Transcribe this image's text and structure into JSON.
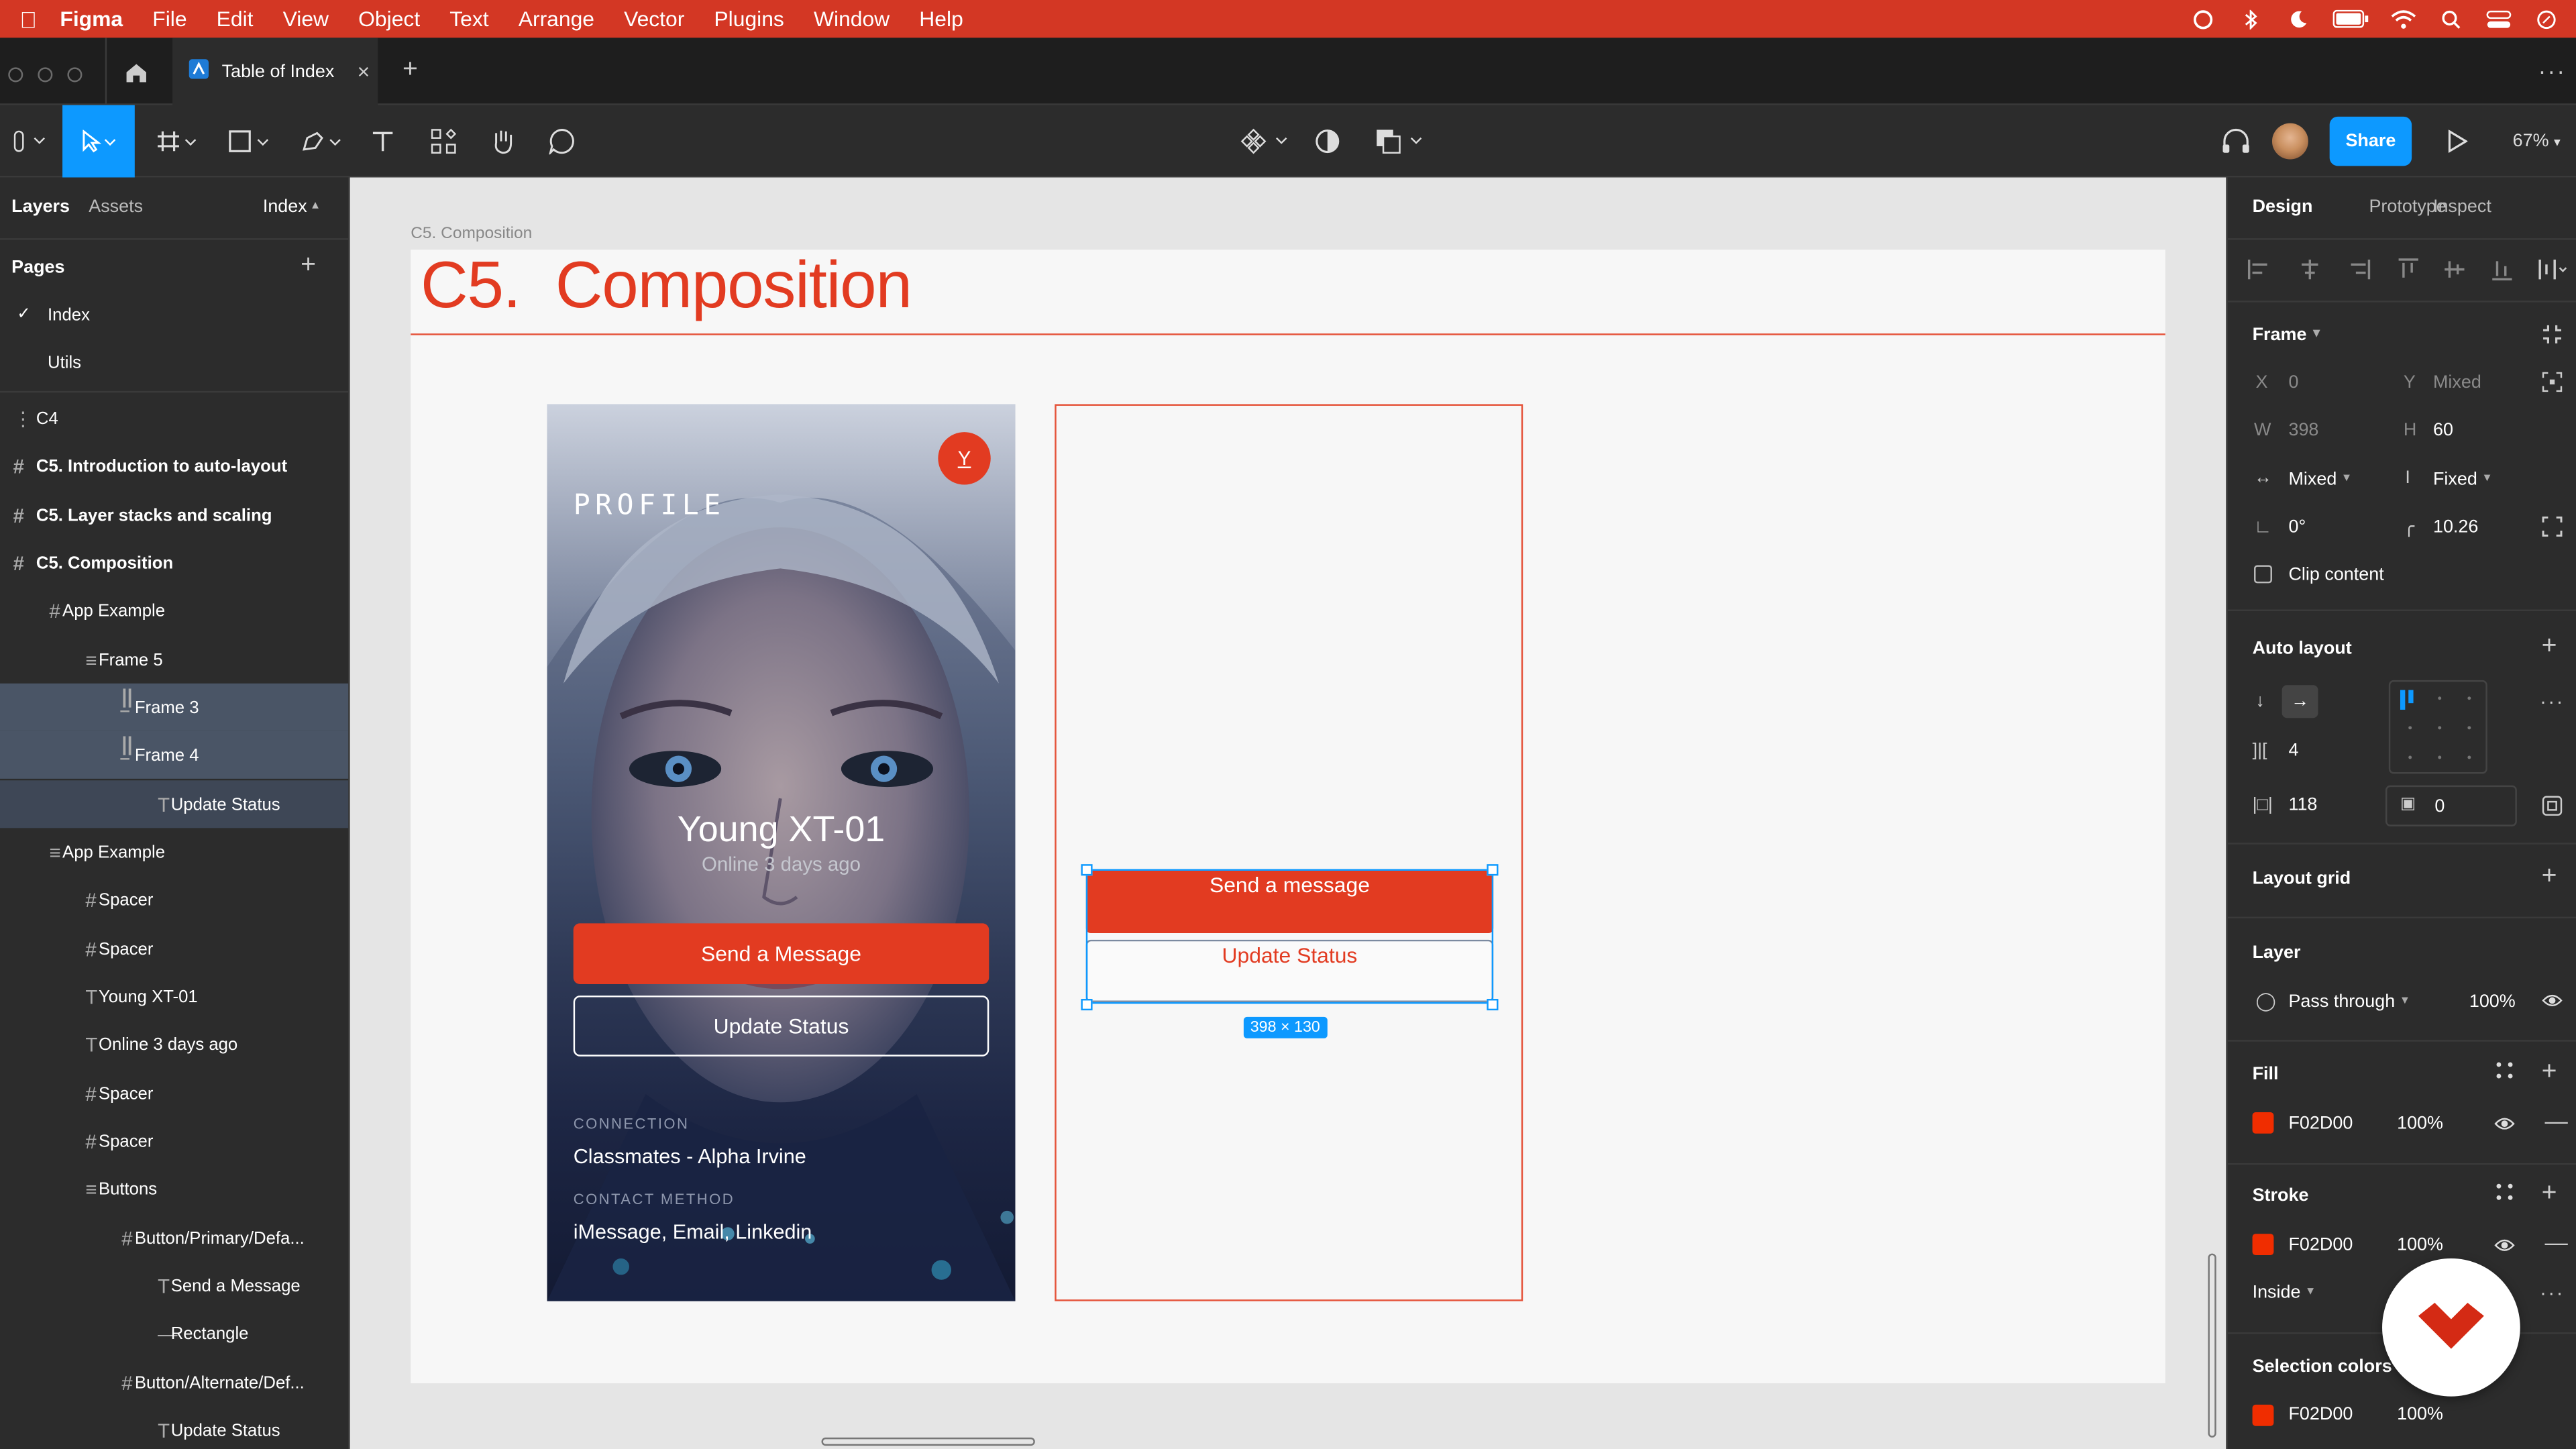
{
  "menubar": {
    "app": "Figma",
    "items": [
      "File",
      "Edit",
      "View",
      "Object",
      "Text",
      "Arrange",
      "Vector",
      "Plugins",
      "Window",
      "Help"
    ]
  },
  "tabs": {
    "active_title": "Table of Index",
    "add_label": "+",
    "close_label": "×"
  },
  "toolbar": {
    "share_label": "Share",
    "zoom_label": "67%"
  },
  "left_panel": {
    "tab_layers": "Layers",
    "tab_assets": "Assets",
    "page_selector": "Index",
    "pages_title": "Pages",
    "pages": [
      {
        "label": "Index",
        "active": true
      },
      {
        "label": "Utils",
        "active": false
      }
    ],
    "layers": [
      {
        "label": "C4",
        "icon": "dashed-frame-icon",
        "indent": 0,
        "bold": false
      },
      {
        "label": "C5. Introduction to auto-layout",
        "icon": "frame-icon",
        "indent": 0,
        "bold": true
      },
      {
        "label": "C5. Layer stacks and scaling",
        "icon": "frame-icon",
        "indent": 0,
        "bold": true
      },
      {
        "label": "C5. Composition",
        "icon": "frame-icon",
        "indent": 0,
        "bold": true
      },
      {
        "label": "App Example",
        "icon": "frame-icon",
        "indent": 1,
        "bold": false
      },
      {
        "label": "Frame 5",
        "icon": "autolayout-vertical-icon",
        "indent": 2,
        "bold": false
      },
      {
        "label": "Frame 3",
        "icon": "autolayout-horizontal-icon",
        "indent": 3,
        "bold": false,
        "selected": true
      },
      {
        "label": "Frame 4",
        "icon": "autolayout-horizontal-icon",
        "indent": 3,
        "bold": false,
        "selected": true
      },
      {
        "label": "Update Status",
        "icon": "text-icon",
        "indent": 4,
        "bold": false,
        "selected2": true
      },
      {
        "label": "App Example",
        "icon": "autolayout-vertical-icon",
        "indent": 1,
        "bold": false
      },
      {
        "label": "Spacer",
        "icon": "frame-icon",
        "indent": 2,
        "bold": false
      },
      {
        "label": "Spacer",
        "icon": "frame-icon",
        "indent": 2,
        "bold": false
      },
      {
        "label": "Young XT-01",
        "icon": "text-icon",
        "indent": 2,
        "bold": false
      },
      {
        "label": "Online 3 days ago",
        "icon": "text-icon",
        "indent": 2,
        "bold": false
      },
      {
        "label": "Spacer",
        "icon": "frame-icon",
        "indent": 2,
        "bold": false
      },
      {
        "label": "Spacer",
        "icon": "frame-icon",
        "indent": 2,
        "bold": false
      },
      {
        "label": "Buttons",
        "icon": "autolayout-vertical-icon",
        "indent": 2,
        "bold": false
      },
      {
        "label": "Button/Primary/Defa...",
        "icon": "frame-icon",
        "indent": 3,
        "bold": false
      },
      {
        "label": "Send a Message",
        "icon": "text-icon",
        "indent": 4,
        "bold": false
      },
      {
        "label": "Rectangle",
        "icon": "rectangle-icon",
        "indent": 4,
        "bold": false
      },
      {
        "label": "Button/Alternate/Def...",
        "icon": "frame-icon",
        "indent": 3,
        "bold": false
      },
      {
        "label": "Update Status",
        "icon": "text-icon",
        "indent": 4,
        "bold": false
      }
    ]
  },
  "canvas": {
    "frame_label": "C5. Composition",
    "heading": "C5.  Composition",
    "profile": {
      "title": "PROFILE",
      "avatar_initial": "Y",
      "name": "Young XT-01",
      "status": "Online 3 days ago",
      "primary_button": "Send a Message",
      "secondary_button": "Update Status",
      "connection_label": "CONNECTION",
      "connection_value": "Classmates - Alpha Irvine",
      "contact_label": "CONTACT METHOD",
      "contact_value": "iMessage, Email, Linkedin"
    },
    "selection": {
      "primary_button": "Send a message",
      "secondary_button": "Update Status",
      "size_badge": "398 × 130"
    }
  },
  "right_panel": {
    "tabs": [
      "Design",
      "Prototype",
      "Inspect"
    ],
    "frame_title": "Frame",
    "x_label": "X",
    "x_value": "0",
    "y_label": "Y",
    "y_value": "Mixed",
    "w_label": "W",
    "w_value": "398",
    "h_label": "H",
    "h_value": "60",
    "resize_h": "Mixed",
    "resize_v": "Fixed",
    "rotation": "0°",
    "radius": "10.26",
    "clip_content": "Clip content",
    "auto_layout_title": "Auto layout",
    "spacing": "4",
    "padding_h": "118",
    "padding_v": "0",
    "layout_grid_title": "Layout grid",
    "layer_title": "Layer",
    "blend_mode": "Pass through",
    "layer_opacity": "100%",
    "fill_title": "Fill",
    "fill_hex": "F02D00",
    "fill_opacity": "100%",
    "stroke_title": "Stroke",
    "stroke_hex": "F02D00",
    "stroke_opacity": "100%",
    "stroke_position": "Inside",
    "selection_colors_title": "Selection colors",
    "selection_color_hex": "F02D00",
    "selection_color_opacity": "100%"
  },
  "colors": {
    "menubar": "#d33724",
    "accent": "#f02d00",
    "figma_blue": "#0d99ff",
    "selection": "#4a5566"
  }
}
